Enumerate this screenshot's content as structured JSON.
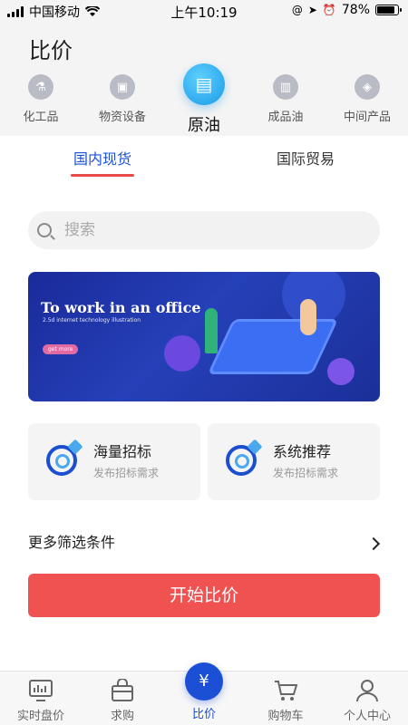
{
  "status_bar": {
    "carrier": "中国移动",
    "time": "上午10:19",
    "battery": "78%"
  },
  "page_title": "比价",
  "categories": [
    {
      "label": "化工品",
      "icon": "flask-icon",
      "active": false
    },
    {
      "label": "物资设备",
      "icon": "equipment-icon",
      "active": false
    },
    {
      "label": "原油",
      "icon": "oil-drum-icon",
      "active": true
    },
    {
      "label": "成品油",
      "icon": "fuel-can-icon",
      "active": false
    },
    {
      "label": "中间产品",
      "icon": "box-icon",
      "active": false
    }
  ],
  "tabs": [
    {
      "label": "国内现货",
      "active": true
    },
    {
      "label": "国际贸易",
      "active": false
    }
  ],
  "search": {
    "placeholder": "搜索"
  },
  "banner": {
    "title": "To work in an office",
    "subtitle": "2.5d internet technology illustration",
    "cta": "get more"
  },
  "cards": [
    {
      "title": "海量招标",
      "desc": "发布招标需求"
    },
    {
      "title": "系统推荐",
      "desc": "发布招标需求"
    }
  ],
  "filter": {
    "label": "更多筛选条件"
  },
  "start_button": "开始比价",
  "tabbar": [
    {
      "label": "实时盘价",
      "icon": "chart-monitor-icon",
      "active": false
    },
    {
      "label": "求购",
      "icon": "shopping-bag-icon",
      "active": false
    },
    {
      "label": "比价",
      "icon": "yen-compare-icon",
      "active": true
    },
    {
      "label": "购物车",
      "icon": "cart-icon",
      "active": false
    },
    {
      "label": "个人中心",
      "icon": "user-icon",
      "active": false
    }
  ],
  "colors": {
    "accent": "#1a4fd6",
    "primary_button": "#f05252",
    "active_tab_underline": "#e84a4a"
  }
}
